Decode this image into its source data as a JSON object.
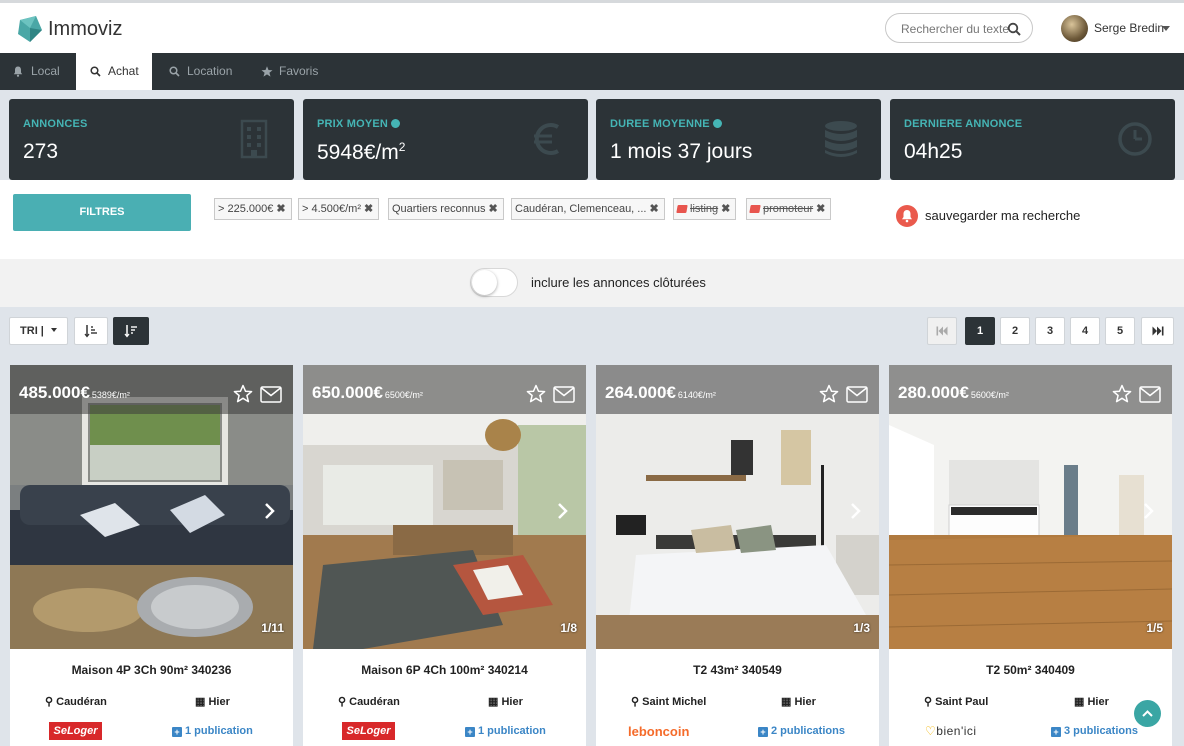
{
  "app": {
    "name": "Immoviz"
  },
  "search": {
    "placeholder": "Rechercher du texte"
  },
  "user": {
    "name": "Serge Bredin"
  },
  "nav": {
    "tabs": [
      {
        "label": "Local",
        "icon": "bell-icon"
      },
      {
        "label": "Achat",
        "icon": "search-icon",
        "active": true
      },
      {
        "label": "Location",
        "icon": "search-icon"
      },
      {
        "label": "Favoris",
        "icon": "star-icon"
      }
    ]
  },
  "stats": [
    {
      "label": "ANNONCES",
      "value": "273",
      "icon": "building-icon"
    },
    {
      "label": "PRIX MOYEN",
      "value": "5948€/m",
      "sup": "2",
      "icon": "euro-icon"
    },
    {
      "label": "DUREE MOYENNE",
      "value": "1 mois 37 jours",
      "icon": "database-icon"
    },
    {
      "label": "DERNIERE ANNONCE",
      "value": "04h25",
      "icon": "clock-icon"
    }
  ],
  "filters": {
    "button_label": "FILTRES",
    "chips": [
      "> 225.000€",
      "> 4.500€/m²",
      "Quartiers reconnus",
      "Caudéran, Clemenceau, ...",
      "listing",
      "promoteur"
    ],
    "save_label": "sauvegarder ma recherche"
  },
  "toggle": {
    "label": "inclure les annonces clôturées",
    "on": false
  },
  "sort": {
    "label": "TRI |"
  },
  "pagination": {
    "pages": [
      "1",
      "2",
      "3",
      "4",
      "5"
    ],
    "current": "1"
  },
  "listings": [
    {
      "price": "485.000€",
      "ppm": "5389€/m²",
      "counter": "1/11",
      "title": "Maison 4P 3Ch 90m² 340236",
      "location": "Caudéran",
      "date": "Hier",
      "publications": "1 publication",
      "source": "SeLoger"
    },
    {
      "price": "650.000€",
      "ppm": "6500€/m²",
      "counter": "1/8",
      "title": "Maison 6P 4Ch 100m² 340214",
      "location": "Caudéran",
      "date": "Hier",
      "publications": "1 publication",
      "source": "SeLoger"
    },
    {
      "price": "264.000€",
      "ppm": "6140€/m²",
      "counter": "1/3",
      "title": "T2 43m² 340549",
      "location": "Saint Michel",
      "date": "Hier",
      "publications": "2 publications",
      "source": "leboncoin"
    },
    {
      "price": "280.000€",
      "ppm": "5600€/m²",
      "counter": "1/5",
      "title": "T2 50m² 340409",
      "location": "Saint Paul",
      "date": "Hier",
      "publications": "3 publications",
      "source": "bien'ici"
    }
  ],
  "colors": {
    "dark": "#2c3337",
    "teal": "#45b5b5",
    "button": "#4aafb3",
    "red": "#ea5a4d",
    "link": "#3b86c6"
  }
}
